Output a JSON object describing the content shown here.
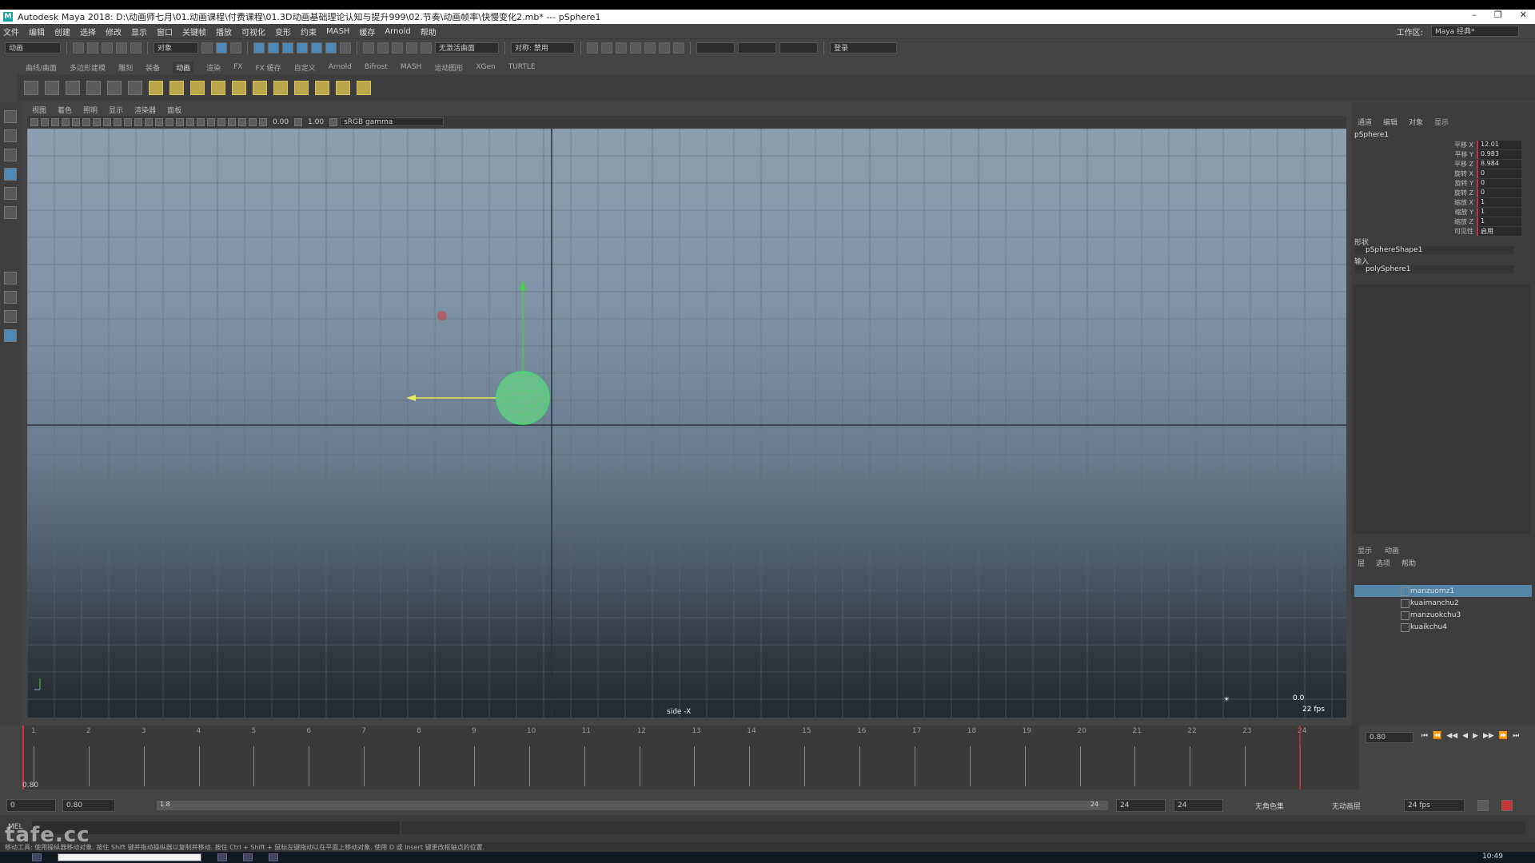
{
  "window": {
    "title": "Autodesk Maya 2018: D:\\动画师七月\\01.动画课程\\付费课程\\01.3D动画基础理论认知与提升999\\02.节奏\\动画帧率\\快慢变化2.mb*  ---  pSphere1",
    "controls": [
      "–",
      "❐",
      "✕"
    ]
  },
  "menubar": {
    "items": [
      "文件",
      "编辑",
      "创建",
      "选择",
      "修改",
      "显示",
      "窗口",
      "关键帧",
      "播放",
      "可视化",
      "变形",
      "约束",
      "MASH",
      "缓存",
      "Arnold",
      "帮助"
    ],
    "workspace_label": "工作区:",
    "workspace_value": "Maya 经典*"
  },
  "statusline": {
    "mode": "动画",
    "object_label": "对象",
    "render_label": "无激活曲面",
    "symmetry": "对称: 禁用",
    "login": "登录"
  },
  "shelf": {
    "tabs": [
      "曲线/曲面",
      "多边形建模",
      "雕刻",
      "装备",
      "动画",
      "渲染",
      "FX",
      "FX 缓存",
      "自定义",
      "Arnold",
      "Bifrost",
      "MASH",
      "运动图形",
      "XGen",
      "TURTLE"
    ],
    "active_tab": "动画"
  },
  "viewport": {
    "menus": [
      "视图",
      "着色",
      "照明",
      "显示",
      "渲染器",
      "面板"
    ],
    "exposure": "0.00",
    "gamma": "1.00",
    "color_space": "sRGB gamma",
    "camera_label": "side -X",
    "fps_label": "22 fps",
    "corner_value": "0.0"
  },
  "channel_box": {
    "tabs": [
      "通道",
      "编辑",
      "对象",
      "显示"
    ],
    "object": "pSphere1",
    "channels": [
      {
        "label": "平移 X",
        "value": "12.01"
      },
      {
        "label": "平移 Y",
        "value": "0.983"
      },
      {
        "label": "平移 Z",
        "value": "8.984"
      },
      {
        "label": "旋转 X",
        "value": "0"
      },
      {
        "label": "旋转 Y",
        "value": "0"
      },
      {
        "label": "旋转 Z",
        "value": "0"
      },
      {
        "label": "缩放 X",
        "value": "1"
      },
      {
        "label": "缩放 Y",
        "value": "1"
      },
      {
        "label": "缩放 Z",
        "value": "1"
      },
      {
        "label": "可见性",
        "value": "启用"
      }
    ],
    "shapes_label": "形状",
    "shape_item": "pSphereShape1",
    "inputs_label": "输入",
    "input_item": "polySphere1"
  },
  "layer_editor": {
    "tabs": [
      "显示",
      "动画"
    ],
    "menus": [
      "层",
      "选项",
      "帮助"
    ],
    "layers": [
      "manzuomz1",
      "kuaimanchu2",
      "manzuokchu3",
      "kuaikchu4"
    ]
  },
  "timeline": {
    "frames": [
      "1",
      "2",
      "3",
      "4",
      "5",
      "6",
      "7",
      "8",
      "9",
      "10",
      "11",
      "12",
      "13",
      "14",
      "15",
      "16",
      "17",
      "18",
      "19",
      "20",
      "21",
      "22",
      "23",
      "24"
    ],
    "current_time": "0.80",
    "start_marker": "0.80",
    "playback_buttons": [
      "⏮",
      "⏪",
      "◀◀",
      "◀",
      "▶",
      "▶▶",
      "⏩",
      "⏭"
    ]
  },
  "range": {
    "start": "0",
    "anim_start": "0.80",
    "range_start": "1.8",
    "range_end": "24",
    "anim_end": "24",
    "anim_end2": "24",
    "char_set": "无角色集",
    "anim_layer": "无动画层",
    "fps": "24 fps"
  },
  "cmdline": {
    "label": "MEL"
  },
  "helpline": {
    "text": "移动工具: 使用操纵器移动对象. 按住 Shift 键并拖动操纵器以复制并移动. 按住 Ctrl + Shift + 鼠标左键拖动以在平面上移动对象. 使用 D 或 Insert 键更改枢轴点的位置."
  },
  "watermark": "tafe.cc",
  "clock": "10:49"
}
